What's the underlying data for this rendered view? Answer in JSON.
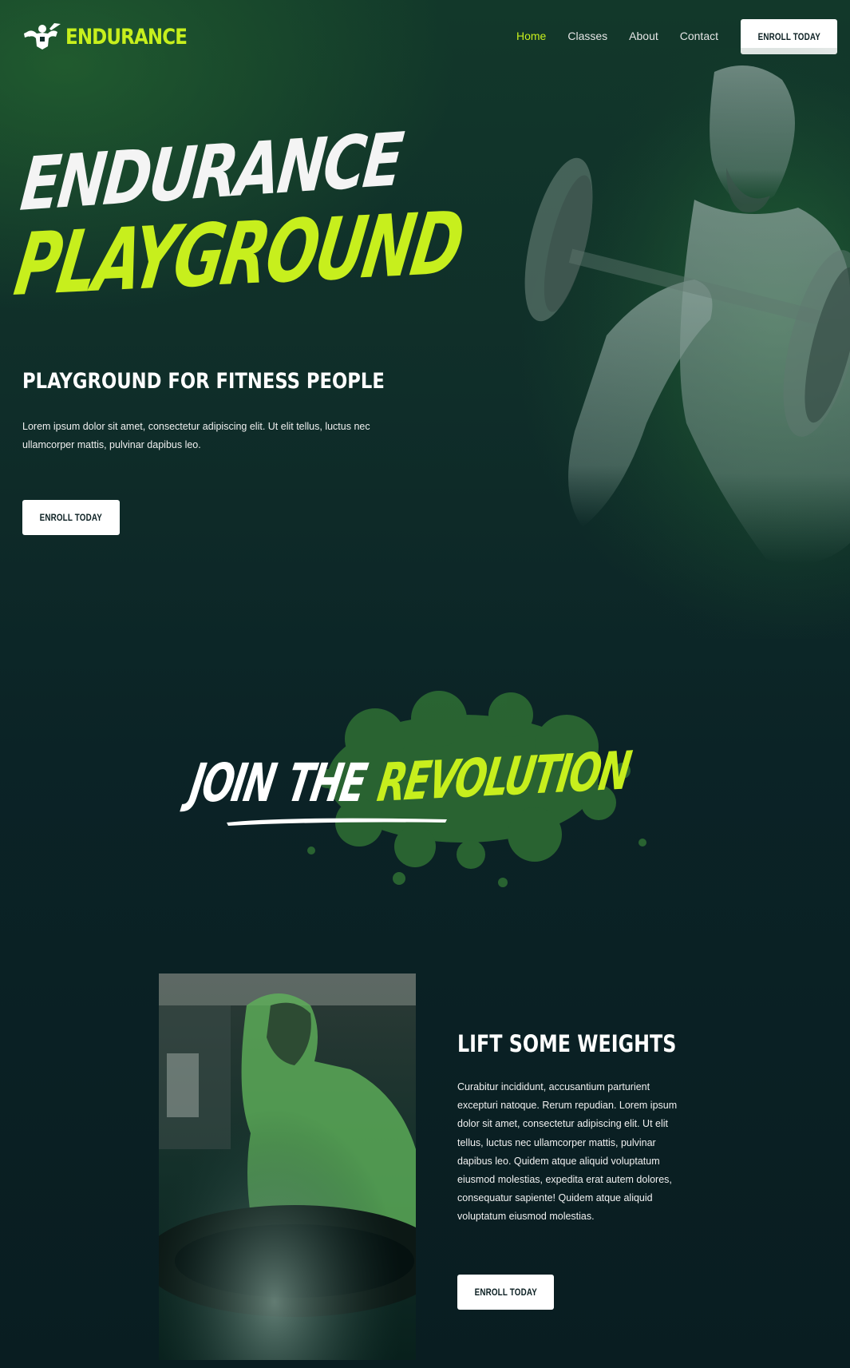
{
  "header": {
    "logo_text": "ENDURANCE",
    "nav": [
      {
        "label": "Home",
        "active": true
      },
      {
        "label": "Classes",
        "active": false
      },
      {
        "label": "About",
        "active": false
      },
      {
        "label": "Contact",
        "active": false
      }
    ],
    "cta_label": "ENROLL TODAY"
  },
  "hero": {
    "title_line1": "ENDURANCE",
    "title_line2": "PLAYGROUND",
    "subtitle": "PLAYGROUND FOR FITNESS PEOPLE",
    "description": "Lorem ipsum dolor sit amet, consectetur adipiscing elit. Ut elit tellus, luctus nec ullamcorper mattis, pulvinar dapibus leo.",
    "cta_label": "ENROLL TODAY"
  },
  "revolution": {
    "word1": "JOIN",
    "word2": "THE",
    "word3": "REVOLUTION"
  },
  "lift": {
    "title": "LIFT SOME WEIGHTS",
    "description": "Curabitur incididunt, accusantium parturient excepturi natoque. Rerum repudian. Lorem ipsum dolor sit amet, consectetur adipiscing elit. Ut elit tellus, luctus nec ullamcorper mattis, pulvinar dapibus leo. Quidem atque aliquid voluptatum eiusmod molestias, expedita erat autem dolores, consequatur sapiente! Quidem atque aliquid voluptatum eiusmod molestias.",
    "cta_label": "ENROLL TODAY"
  },
  "colors": {
    "accent": "#c7ef1d",
    "background": "#0b1f22",
    "text": "#ffffff",
    "button_bg": "#ffffff",
    "button_text": "#0b1f22"
  },
  "icons": {
    "logo": "bodybuilder-icon"
  }
}
